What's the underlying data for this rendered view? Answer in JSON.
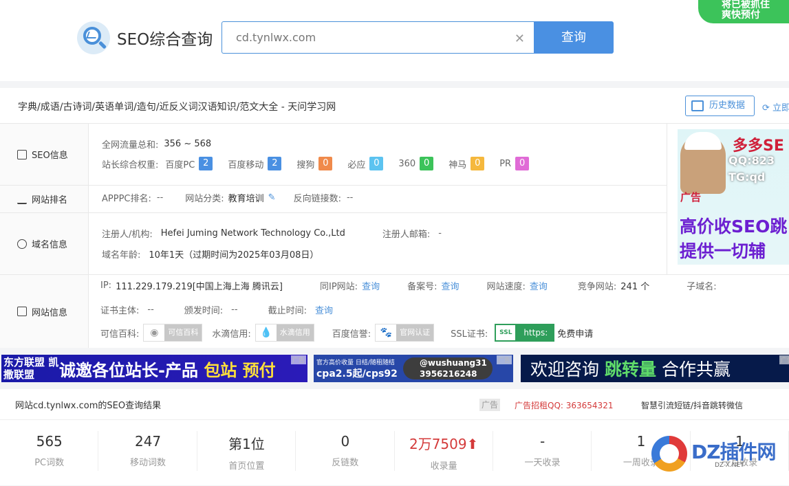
{
  "header": {
    "logo_text": "SEO综合查询",
    "search_value": "cd.tynlwx.com",
    "search_button": "查询",
    "top_ad_line1": "将已被抓住",
    "top_ad_line2": "爽快预付"
  },
  "panel": {
    "site_title": "字典/成语/古诗词/英语单词/造句/近反义词汉语知识/范文大全 - 天问学习网",
    "history_button": "历史数据",
    "refresh_label": "立即",
    "seo_label": "SEO信息",
    "rank_label": "网站排名",
    "domain_label": "域名信息",
    "site_label": "网站信息",
    "traffic_label": "全网流量总和:",
    "traffic_value": "356 ~ 568",
    "weight_label": "站长综合权重:",
    "weights": [
      {
        "name": "百度PC",
        "value": "2",
        "color": "#4a90e2"
      },
      {
        "name": "百度移动",
        "value": "2",
        "color": "#4a90e2"
      },
      {
        "name": "搜狗",
        "value": "0",
        "color": "#f08a4b"
      },
      {
        "name": "必应",
        "value": "0",
        "color": "#5cc3f0"
      },
      {
        "name": "360",
        "value": "0",
        "color": "#3cc35a"
      },
      {
        "name": "神马",
        "value": "0",
        "color": "#f5b83d"
      },
      {
        "name": "PR",
        "value": "0",
        "color": "#e06bd6"
      }
    ],
    "apppc_label": "APPPC排名:",
    "apppc_value": "--",
    "category_label": "网站分类:",
    "category_value": "教育培训",
    "backlinks_label": "反向链接数:",
    "backlinks_value": "--",
    "registrant_label": "注册人/机构:",
    "registrant_value": "Hefei Juming Network Technology Co.,Ltd",
    "email_label": "注册人邮箱:",
    "email_value": "-",
    "age_label": "域名年龄:",
    "age_value": "10年1天（过期时间为2025年03月08日）",
    "ip_label": "IP:",
    "ip_value": "111.229.179.219[中国上海上海 腾讯云]",
    "same_ip_label": "同IP网站:",
    "icp_label": "备案号:",
    "speed_label": "网站速度:",
    "query_link": "查询",
    "competitor_label": "竞争网站:",
    "competitor_value": "241 个",
    "subdomain_label": "子域名:",
    "cert_subject_label": "证书主体:",
    "cert_subject_value": "--",
    "issue_time_label": "颁发时间:",
    "issue_time_value": "--",
    "expire_time_label": "截止时间:",
    "trust_baike_label": "可信百科:",
    "trust_baike_badge": "可信百科",
    "shuidi_label": "水滴信用:",
    "shuidi_badge": "水滴信用",
    "baidu_trust_label": "百度信誉:",
    "baidu_trust_badge": "官网认证",
    "ssl_label": "SSL证书:",
    "ssl_badge": "https:",
    "ssl_icon_text": "SSL",
    "ssl_apply": "免费申请"
  },
  "side_ad": {
    "line1": "多多SE",
    "line2": "QQ:823",
    "line3": "TG:qd",
    "tag": "广告",
    "line4": "高价收SEO跳",
    "line5": "提供一切辅"
  },
  "banners": {
    "b1_left": "东方联盟 凯撒联盟",
    "b1_main": "诚邀各位站长-产品",
    "b1_hl": "包站 预付",
    "b2_left_small": "官方高价收量 日结/随租随结",
    "b2_left_big": "cpa2.5起/cps92",
    "b2_right1": "@wushuang31",
    "b2_right2": "3956216248",
    "b3_a": "欢迎咨询",
    "b3_hl": "跳转量",
    "b3_b": "合作共赢",
    "ad_tag": "广告"
  },
  "results": {
    "title": "网站cd.tynlwx.com的SEO查询结果",
    "ad_label": "广告",
    "ad_qq": "广告招租QQ: 363654321",
    "ad_jump": "智慧引流短链/抖音跳转微信",
    "stats": [
      {
        "num": "565",
        "label": "PC词数"
      },
      {
        "num": "247",
        "label": "移动词数"
      },
      {
        "num": "第1位",
        "label": "首页位置"
      },
      {
        "num": "0",
        "label": "反链数"
      },
      {
        "num": "2万7509⬆",
        "label": "收录量"
      },
      {
        "num": "-",
        "label": "一天收录"
      },
      {
        "num": "1",
        "label": "一周收录"
      },
      {
        "num": "1",
        "label": "一月收录"
      }
    ]
  },
  "watermark": {
    "text": "DZ插件网",
    "sub": "DZ-X.NET"
  }
}
